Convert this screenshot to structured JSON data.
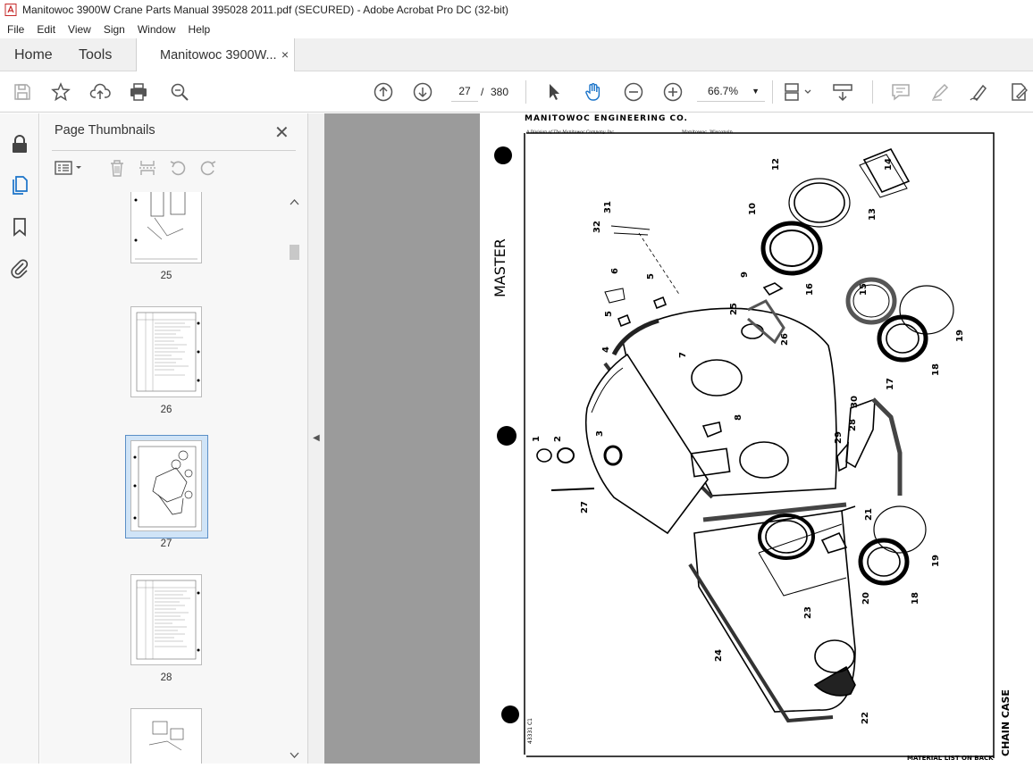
{
  "window": {
    "title": "Manitowoc 3900W Crane Parts Manual 395028 2011.pdf (SECURED) - Adobe Acrobat Pro DC (32-bit)"
  },
  "menu": [
    "File",
    "Edit",
    "View",
    "Sign",
    "Window",
    "Help"
  ],
  "tabs": {
    "home": "Home",
    "tools": "Tools",
    "document": "Manitowoc 3900W...",
    "close": "×"
  },
  "toolbar": {
    "current_page": "27",
    "separator": "/",
    "total_pages": "380",
    "zoom": "66.7%",
    "icons_left": [
      "save-icon",
      "bookmark-star-icon",
      "upload-icon",
      "print-icon",
      "find-zoom-icon"
    ],
    "icons_nav": [
      "page-up-icon",
      "page-down-icon"
    ],
    "icons_tools": [
      "select-arrow-icon",
      "hand-tool-icon",
      "zoom-out-icon",
      "zoom-in-icon"
    ],
    "icons_right": [
      "page-display-icon",
      "scroll-mode-icon",
      "comment-icon",
      "highlight-icon",
      "sign-icon",
      "edit-pdf-icon"
    ]
  },
  "sidebar": {
    "icons": [
      "lock-icon",
      "page-thumbnails-icon",
      "bookmark-icon",
      "attachment-icon"
    ]
  },
  "thumbnails_panel": {
    "title": "Page Thumbnails",
    "close": "✕",
    "pages": [
      "25",
      "26",
      "27",
      "28"
    ],
    "selected_page": "27"
  },
  "document_page": {
    "header": "MANITOWOC ENGINEERING CO.",
    "subheader_left": "A Division of The Manitowoc Company, Inc.",
    "subheader_right": "Manitowoc, Wisconsin",
    "side_label": "MASTER",
    "figure_label": "CHAIN CASE",
    "footer": "MATERIAL LIST ON BACK",
    "drawing_number": "43331 C1",
    "callouts": [
      "1",
      "2",
      "3",
      "4",
      "5",
      "5",
      "6",
      "7",
      "8",
      "9",
      "10",
      "12",
      "13",
      "14",
      "15",
      "16",
      "17",
      "18",
      "18",
      "19",
      "19",
      "20",
      "21",
      "22",
      "23",
      "24",
      "25",
      "26",
      "27",
      "28",
      "29",
      "30",
      "31",
      "32"
    ]
  }
}
